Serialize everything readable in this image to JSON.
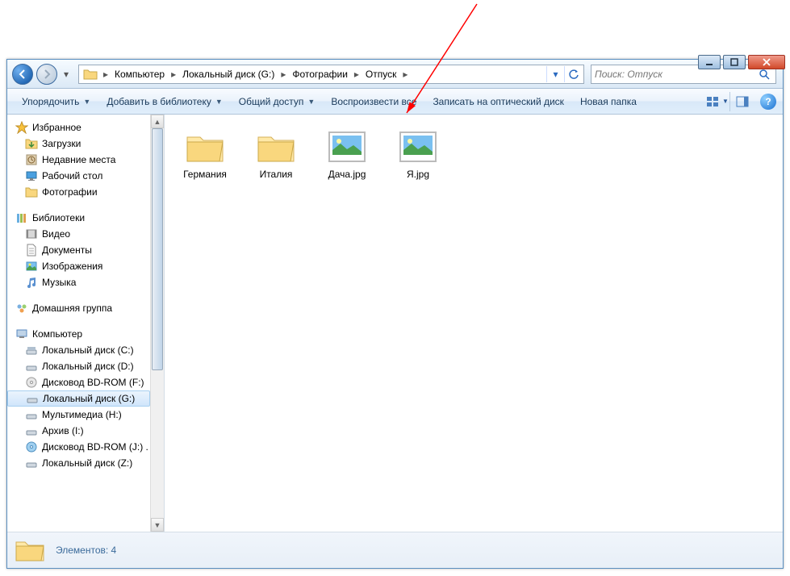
{
  "breadcrumb": {
    "items": [
      "Компьютер",
      "Локальный диск (G:)",
      "Фотографии",
      "Отпуск"
    ]
  },
  "search": {
    "placeholder": "Поиск: Отпуск"
  },
  "toolbar": {
    "organize": "Упорядочить",
    "include": "Добавить в библиотеку",
    "share": "Общий доступ",
    "play_all": "Воспроизвести все",
    "burn": "Записать на оптический диск",
    "new_folder": "Новая папка"
  },
  "sidebar": {
    "favorites": "Избранное",
    "fav_items": [
      "Загрузки",
      "Недавние места",
      "Рабочий стол",
      "Фотографии"
    ],
    "libraries": "Библиотеки",
    "lib_items": [
      "Видео",
      "Документы",
      "Изображения",
      "Музыка"
    ],
    "homegroup": "Домашняя группа",
    "computer": "Компьютер",
    "drives": [
      "Локальный диск (C:)",
      "Локальный диск (D:)",
      "Дисковод BD-ROM (F:)",
      "Локальный диск (G:)",
      "Мультимедиа (H:)",
      "Архив (I:)",
      "Дисковод BD-ROM (J:) .",
      "Локальный диск (Z:)"
    ]
  },
  "files": {
    "items": [
      {
        "name": "Германия",
        "type": "folder"
      },
      {
        "name": "Италия",
        "type": "folder"
      },
      {
        "name": "Дача.jpg",
        "type": "image"
      },
      {
        "name": "Я.jpg",
        "type": "image"
      }
    ]
  },
  "status": {
    "text": "Элементов: 4"
  }
}
